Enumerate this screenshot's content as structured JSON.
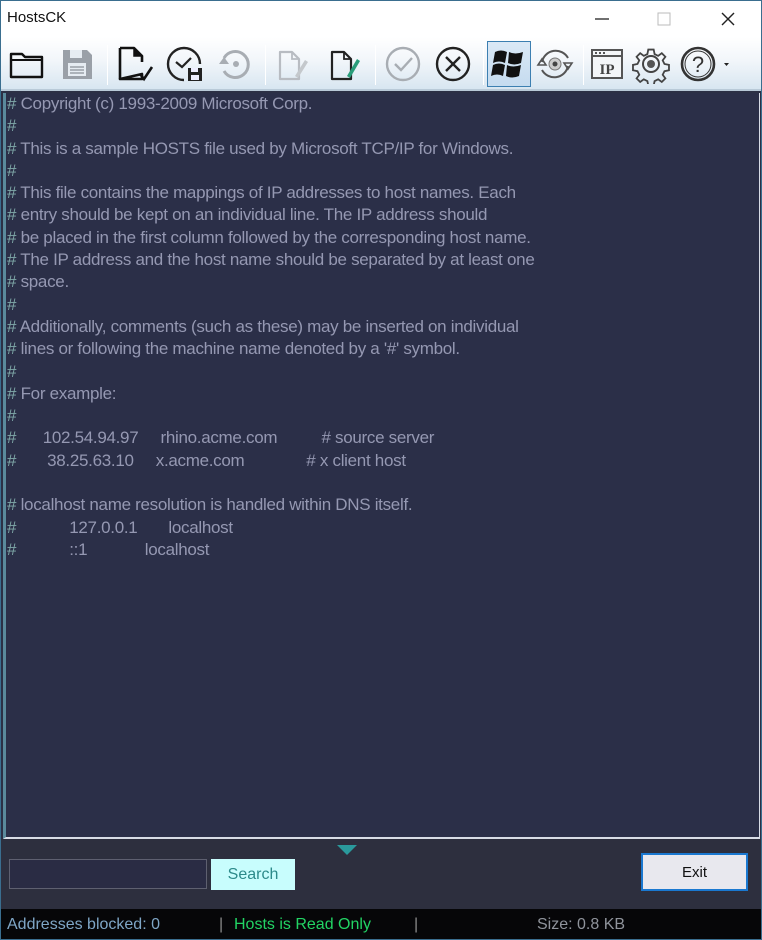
{
  "window": {
    "title": "HostsCK",
    "controls": {
      "minimize": "minimize",
      "maximize": "maximize",
      "close": "close"
    }
  },
  "toolbar": {
    "buttons": [
      {
        "name": "open-file",
        "icon": "folder-icon",
        "enabled": true
      },
      {
        "name": "save",
        "icon": "floppy-disk-icon",
        "enabled": false
      },
      {
        "name": "check-document",
        "icon": "document-check-icon",
        "enabled": true
      },
      {
        "name": "scheduled-backup",
        "icon": "clock-save-icon",
        "enabled": true
      },
      {
        "name": "restore",
        "icon": "restore-icon",
        "enabled": false
      },
      {
        "name": "edit-disabled",
        "icon": "document-edit-icon",
        "enabled": false
      },
      {
        "name": "edit",
        "icon": "document-pencil-icon",
        "enabled": true
      },
      {
        "name": "apply",
        "icon": "check-circle-icon",
        "enabled": false
      },
      {
        "name": "cancel",
        "icon": "x-circle-icon",
        "enabled": true
      },
      {
        "name": "windows",
        "icon": "windows-logo-icon",
        "enabled": true,
        "active": true
      },
      {
        "name": "refresh-dns",
        "icon": "rotate-disc-icon",
        "enabled": true
      },
      {
        "name": "ip-info",
        "icon": "ip-window-icon",
        "enabled": true
      },
      {
        "name": "settings",
        "icon": "gear-icon",
        "enabled": true
      },
      {
        "name": "help",
        "icon": "question-circle-icon",
        "enabled": true,
        "has_dropdown": true
      }
    ]
  },
  "editor": {
    "lines": [
      "# Copyright (c) 1993-2009 Microsoft Corp.",
      "#",
      "# This is a sample HOSTS file used by Microsoft TCP/IP for Windows.",
      "#",
      "# This file contains the mappings of IP addresses to host names. Each",
      "# entry should be kept on an individual line. The IP address should",
      "# be placed in the first column followed by the corresponding host name.",
      "# The IP address and the host name should be separated by at least one",
      "# space.",
      "#",
      "# Additionally, comments (such as these) may be inserted on individual",
      "# lines or following the machine name denoted by a '#' symbol.",
      "#",
      "# For example:",
      "#",
      "#      102.54.94.97     rhino.acme.com          # source server",
      "#       38.25.63.10     x.acme.com              # x client host",
      "",
      "# localhost name resolution is handled within DNS itself.",
      "#\t127.0.0.1       localhost",
      "#\t::1             localhost"
    ]
  },
  "search": {
    "value": "",
    "placeholder": "",
    "button_label": "Search"
  },
  "exit_button_label": "Exit",
  "statusbar": {
    "blocked": "Addresses blocked: 0",
    "separator": "|",
    "readonly": "Hosts is Read Only",
    "size": "Size: 0.8 KB"
  },
  "colors": {
    "editor_bg": "#2b2f48",
    "editor_text": "#9598b2",
    "readonly_status": "#22d464",
    "search_button_bg": "#c8fdfd",
    "exit_border": "#1a78d0"
  }
}
